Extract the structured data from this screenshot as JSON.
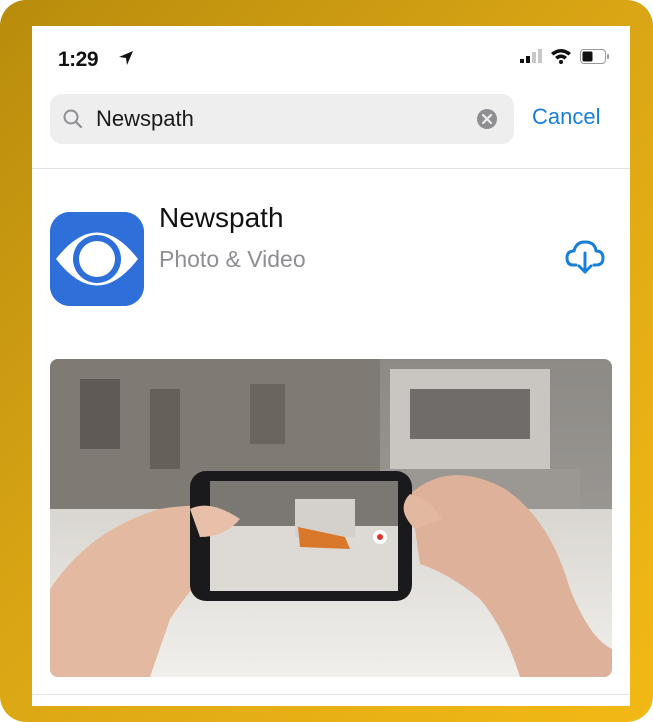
{
  "status_bar": {
    "time": "1:29",
    "icons": [
      "location-arrow-icon",
      "cellular-signal-icon",
      "wifi-icon",
      "battery-icon"
    ]
  },
  "search": {
    "query": "Newspath",
    "cancel_label": "Cancel"
  },
  "result": {
    "app_name": "Newspath",
    "category": "Photo & Video",
    "icon": "cbs-eye-logo",
    "action_icon": "cloud-download-icon"
  },
  "colors": {
    "accent": "#1a7fd6",
    "app_icon_bg": "#2f6fd9",
    "frame": "#d9a515",
    "secondary_text": "#8e8e93"
  }
}
